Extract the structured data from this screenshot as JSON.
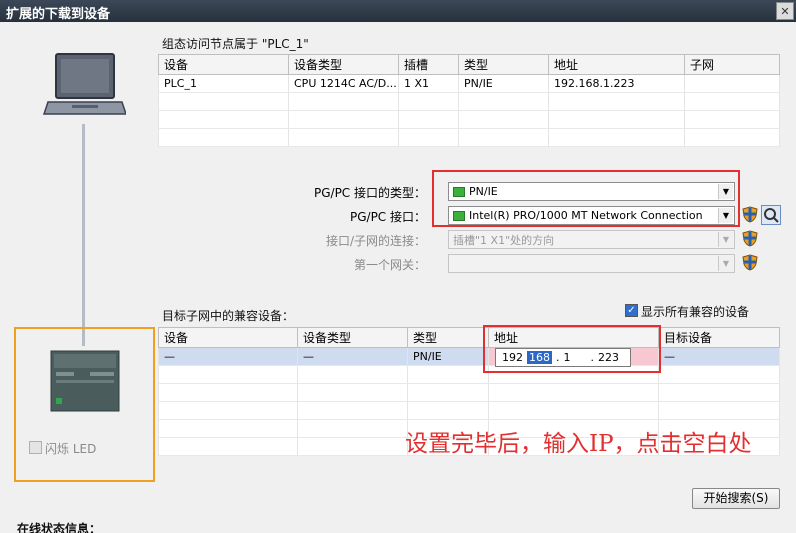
{
  "window": {
    "title": "扩展的下载到设备",
    "close_symbol": "✕"
  },
  "access_nodes": {
    "caption": "组态访问节点属于 \"PLC_1\"",
    "headers": [
      "设备",
      "设备类型",
      "插槽",
      "类型",
      "地址",
      "子网"
    ],
    "rows": [
      [
        "PLC_1",
        "CPU 1214C AC/D...",
        "1 X1",
        "PN/IE",
        "192.168.1.223",
        ""
      ]
    ]
  },
  "interface": {
    "type_label": "PG/PC 接口的类型：",
    "type_value": "PN/IE",
    "if_label": "PG/PC 接口：",
    "if_value": "Intel(R) PRO/1000 MT Network Connection",
    "conn_label": "接口/子网的连接：",
    "conn_value": "插槽\"1 X1\"处的方向",
    "gateway_label": "第一个网关：",
    "gateway_value": ""
  },
  "compatible": {
    "caption": "目标子网中的兼容设备：",
    "show_all_label": "显示所有兼容的设备",
    "show_all_checked": true,
    "headers": [
      "设备",
      "设备类型",
      "类型",
      "地址",
      "目标设备"
    ],
    "row": {
      "device": "—",
      "device_type": "—",
      "type": "PN/IE",
      "target": "—"
    },
    "ip": [
      "192",
      "168",
      "1",
      "223"
    ]
  },
  "left_panel": {
    "flash_led_label": "闪烁 LED",
    "flash_led_checked": false
  },
  "buttons": {
    "start_search": "开始搜索(S)"
  },
  "annotation": {
    "text": "设置完毕后，输入IP，点击空白处"
  },
  "status": {
    "label": "在线状态信息："
  },
  "colors": {
    "highlight_red": "#e23030",
    "highlight_orange": "#f0a020",
    "row_selected": "#cfdcf0"
  }
}
